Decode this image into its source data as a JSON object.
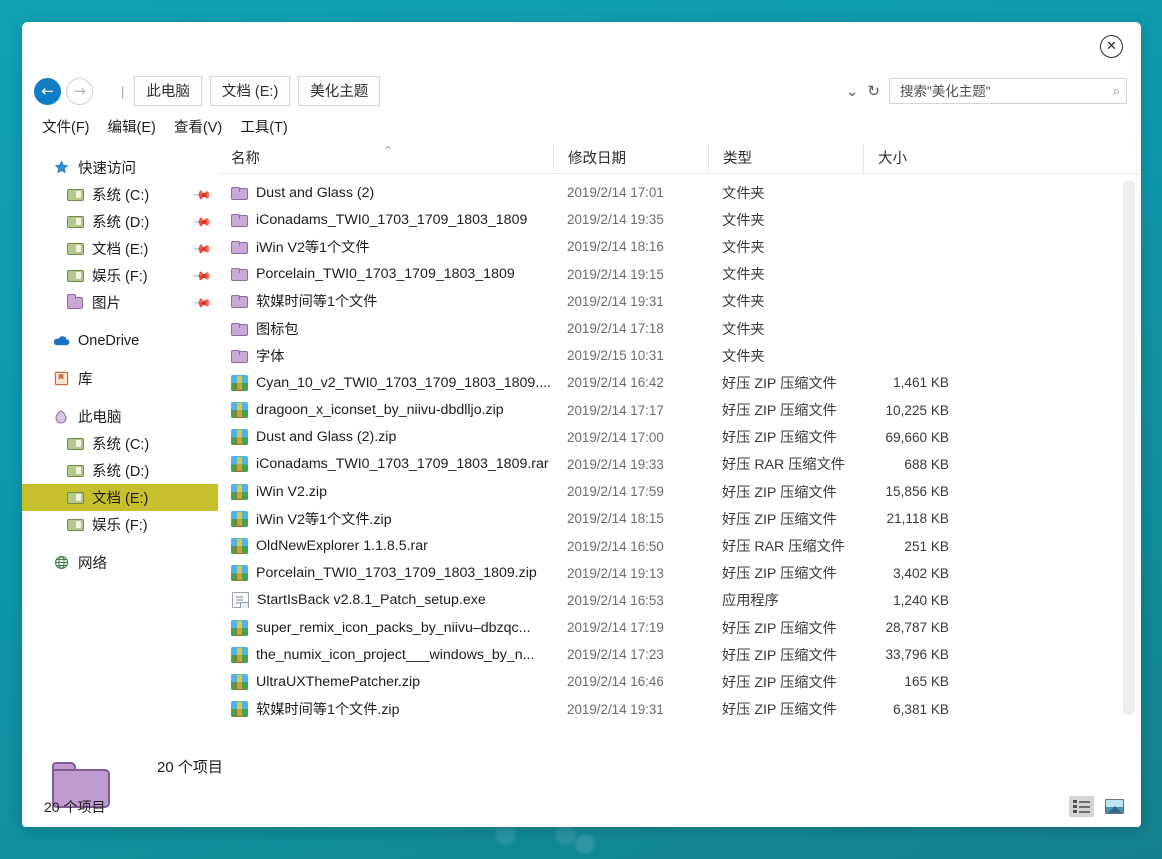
{
  "desktop": {
    "background_color": "#0f9eaf"
  },
  "window": {
    "close_label": "✕",
    "navigation": {
      "back_glyph": "←",
      "forward_glyph": "→",
      "path_separator": "|",
      "breadcrumbs": [
        "此电脑",
        "文档 (E:)",
        "美化主题"
      ],
      "history_caret": "⌄",
      "refresh_glyph": "↻",
      "search_placeholder": "搜索\"美化主题\"",
      "search_value": "",
      "search_icon_glyph": "⌕"
    },
    "menubar": [
      "文件(F)",
      "编辑(E)",
      "查看(V)",
      "工具(T)"
    ]
  },
  "sidebar": {
    "groups": [
      {
        "header": {
          "label": "快速访问",
          "icon": "star-icon",
          "indent": "lvl0"
        },
        "items": [
          {
            "label": "系统 (C:)",
            "icon": "drive-icon",
            "pinned": true,
            "indent": "lvl1"
          },
          {
            "label": "系统 (D:)",
            "icon": "drive-icon",
            "pinned": true,
            "indent": "lvl1"
          },
          {
            "label": "文档 (E:)",
            "icon": "drive-icon",
            "pinned": true,
            "indent": "lvl1"
          },
          {
            "label": "娱乐 (F:)",
            "icon": "drive-icon",
            "pinned": true,
            "indent": "lvl1"
          },
          {
            "label": "图片",
            "icon": "folder-icon",
            "pinned": true,
            "indent": "lvl1"
          }
        ]
      },
      {
        "header": {
          "label": "OneDrive",
          "icon": "cloud-icon",
          "indent": "lvl0"
        },
        "items": []
      },
      {
        "header": {
          "label": "库",
          "icon": "library-icon",
          "indent": "lvl0"
        },
        "items": []
      },
      {
        "header": {
          "label": "此电脑",
          "icon": "computer-icon",
          "indent": "lvl0"
        },
        "items": [
          {
            "label": "系统 (C:)",
            "icon": "drive-icon",
            "pinned": false,
            "indent": "lvl1",
            "selected": false
          },
          {
            "label": "系统 (D:)",
            "icon": "drive-icon",
            "pinned": false,
            "indent": "lvl1",
            "selected": false
          },
          {
            "label": "文档 (E:)",
            "icon": "drive-icon",
            "pinned": false,
            "indent": "lvl1",
            "selected": true
          },
          {
            "label": "娱乐 (F:)",
            "icon": "drive-icon",
            "pinned": false,
            "indent": "lvl1",
            "selected": false
          }
        ]
      },
      {
        "header": {
          "label": "网络",
          "icon": "network-icon",
          "indent": "lvl0"
        },
        "items": []
      }
    ],
    "selected_highlight_color": "#c6c02e"
  },
  "file_list": {
    "columns": [
      "名称",
      "修改日期",
      "类型",
      "大小"
    ],
    "sort_column": "名称",
    "sort_direction_glyph": "⌃",
    "rows": [
      {
        "name": "Dust and Glass (2)",
        "date": "2019/2/14 17:01",
        "type": "文件夹",
        "size": "",
        "icon": "folder-icon"
      },
      {
        "name": "iConadams_TWI0_1703_1709_1803_1809",
        "date": "2019/2/14 19:35",
        "type": "文件夹",
        "size": "",
        "icon": "folder-icon"
      },
      {
        "name": "iWin V2等1个文件",
        "date": "2019/2/14 18:16",
        "type": "文件夹",
        "size": "",
        "icon": "folder-icon"
      },
      {
        "name": "Porcelain_TWI0_1703_1709_1803_1809",
        "date": "2019/2/14 19:15",
        "type": "文件夹",
        "size": "",
        "icon": "folder-icon"
      },
      {
        "name": "软媒时间等1个文件",
        "date": "2019/2/14 19:31",
        "type": "文件夹",
        "size": "",
        "icon": "folder-icon"
      },
      {
        "name": "图标包",
        "date": "2019/2/14 17:18",
        "type": "文件夹",
        "size": "",
        "icon": "folder-icon"
      },
      {
        "name": "字体",
        "date": "2019/2/15 10:31",
        "type": "文件夹",
        "size": "",
        "icon": "folder-icon"
      },
      {
        "name": "Cyan_10_v2_TWI0_1703_1709_1803_1809....",
        "date": "2019/2/14 16:42",
        "type": "好压 ZIP 压缩文件",
        "size": "1,461 KB",
        "icon": "archive-icon"
      },
      {
        "name": "dragoon_x_iconset_by_niivu-dbdlljo.zip",
        "date": "2019/2/14 17:17",
        "type": "好压 ZIP 压缩文件",
        "size": "10,225 KB",
        "icon": "archive-icon"
      },
      {
        "name": "Dust and Glass (2).zip",
        "date": "2019/2/14 17:00",
        "type": "好压 ZIP 压缩文件",
        "size": "69,660 KB",
        "icon": "archive-icon"
      },
      {
        "name": "iConadams_TWI0_1703_1709_1803_1809.rar",
        "date": "2019/2/14 19:33",
        "type": "好压 RAR 压缩文件",
        "size": "688 KB",
        "icon": "archive-icon"
      },
      {
        "name": "iWin V2.zip",
        "date": "2019/2/14 17:59",
        "type": "好压 ZIP 压缩文件",
        "size": "15,856 KB",
        "icon": "archive-icon"
      },
      {
        "name": "iWin V2等1个文件.zip",
        "date": "2019/2/14 18:15",
        "type": "好压 ZIP 压缩文件",
        "size": "21,118 KB",
        "icon": "archive-icon"
      },
      {
        "name": "OldNewExplorer 1.1.8.5.rar",
        "date": "2019/2/14 16:50",
        "type": "好压 RAR 压缩文件",
        "size": "251 KB",
        "icon": "archive-icon"
      },
      {
        "name": "Porcelain_TWI0_1703_1709_1803_1809.zip",
        "date": "2019/2/14 19:13",
        "type": "好压 ZIP 压缩文件",
        "size": "3,402 KB",
        "icon": "archive-icon"
      },
      {
        "name": "StartIsBack   v2.8.1_Patch_setup.exe",
        "date": "2019/2/14 16:53",
        "type": "应用程序",
        "size": "1,240 KB",
        "icon": "exe-icon"
      },
      {
        "name": "super_remix_icon_packs_by_niivu–dbzqc...",
        "date": "2019/2/14 17:19",
        "type": "好压 ZIP 压缩文件",
        "size": "28,787 KB",
        "icon": "archive-icon"
      },
      {
        "name": "the_numix_icon_project___windows_by_n...",
        "date": "2019/2/14 17:23",
        "type": "好压 ZIP 压缩文件",
        "size": "33,796 KB",
        "icon": "archive-icon"
      },
      {
        "name": "UltraUXThemePatcher.zip",
        "date": "2019/2/14 16:46",
        "type": "好压 ZIP 压缩文件",
        "size": "165 KB",
        "icon": "archive-icon"
      },
      {
        "name": "软媒时间等1个文件.zip",
        "date": "2019/2/14 19:31",
        "type": "好压 ZIP 压缩文件",
        "size": "6,381 KB",
        "icon": "archive-icon"
      }
    ]
  },
  "status": {
    "item_count_top": "20 个项目",
    "item_count_bottom": "20 个项目"
  },
  "view_toggles": {
    "details_label": "details-view",
    "thumbnail_label": "thumbnail-view",
    "active": "details"
  }
}
